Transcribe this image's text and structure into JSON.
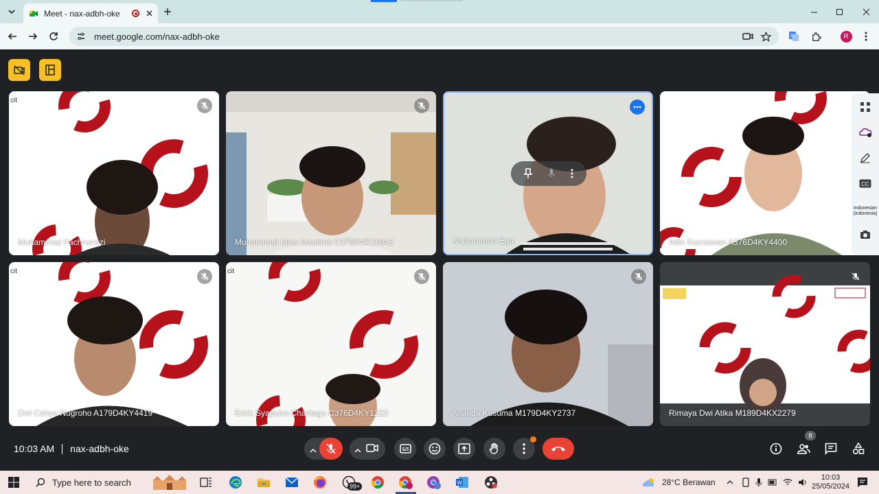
{
  "browser": {
    "tab_title": "Meet - nax-adbh-oke",
    "url": "meet.google.com/nax-adbh-oke",
    "profile_initial": "R"
  },
  "meeting": {
    "time": "10:03 AM",
    "code": "nax-adbh-oke",
    "participant_count": "8",
    "caption_language": "Indonesian (Indonesia)"
  },
  "participants": [
    {
      "name": "Muhammad Fachrurrozi",
      "muted": true
    },
    {
      "name": "Muhammad Mico Maulana C376D4KY0842",
      "muted": true
    },
    {
      "name": "Muhammad Ega",
      "muted": false
    },
    {
      "name": "Alfin Kurniawan A376D4KY4400",
      "muted": false
    },
    {
      "name": "Dwi Cahyo Nugroho A179D4KY4419",
      "muted": true
    },
    {
      "name": "Erick Syaputra Chaniago C376D4KY1223",
      "muted": true
    },
    {
      "name": "Ananda Kusuma M179D4KY2737",
      "muted": true
    },
    {
      "name": "Rimaya Dwi Atika M189D4KX2279",
      "muted": true
    }
  ],
  "taskbar": {
    "search_placeholder": "Type here to search",
    "whatsapp_badge": "99+",
    "weather": "28°C  Berawan",
    "clock_time": "10:03",
    "clock_date": "25/05/2024"
  },
  "colors": {
    "meet_bg": "#202124",
    "accent_yellow": "#f6c026",
    "end_call_red": "#ea4335",
    "logo_red": "#b5121b",
    "active_border": "#8ab4f8"
  }
}
